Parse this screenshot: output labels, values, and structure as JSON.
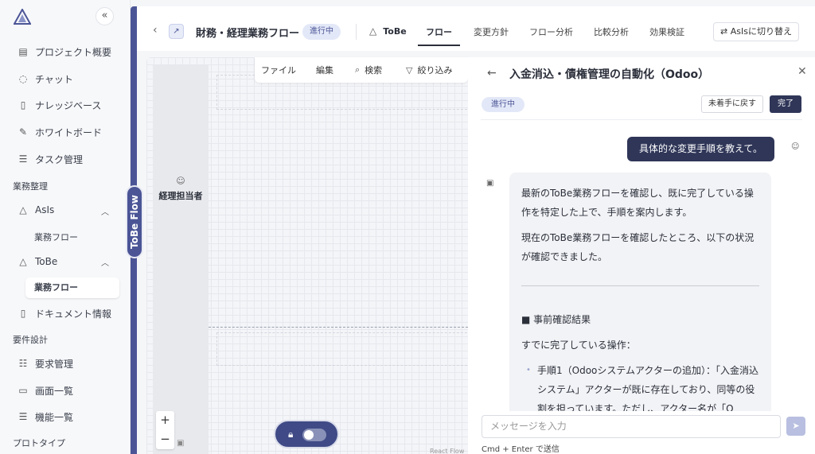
{
  "sidebar": {
    "collapse_icon": "«",
    "items": [
      {
        "icon": "clipboard-icon",
        "label": "プロジェクト概要"
      },
      {
        "icon": "chat-icon",
        "label": "チャット"
      },
      {
        "icon": "book-icon",
        "label": "ナレッジベース"
      },
      {
        "icon": "pen-icon",
        "label": "ホワイトボード"
      },
      {
        "icon": "task-list-icon",
        "label": "タスク管理"
      }
    ],
    "section_business": "業務整理",
    "asis_label": "AsIs",
    "asis_sub": "業務フロー",
    "tobe_label": "ToBe",
    "tobe_sub": "業務フロー",
    "doc_label": "ドキュメント情報",
    "section_requirements": "要件設計",
    "req_items": [
      {
        "icon": "list-icon",
        "label": "要求管理"
      },
      {
        "icon": "monitor-icon",
        "label": "画面一覧"
      },
      {
        "icon": "list-icon",
        "label": "機能一覧"
      }
    ],
    "section_prototype": "プロトタイプ"
  },
  "flow_tag": "ToBe Flow",
  "header": {
    "title": "財務・経理業務フロー",
    "status": "進行中",
    "tobe": "ToBe",
    "tabs": [
      "フロー",
      "変更方針",
      "フロー分析",
      "比較分析",
      "効果検証"
    ],
    "active_tab": "フロー",
    "switch_label": "AsIsに切り替え"
  },
  "canvas": {
    "actor": "経理担当者",
    "toolbar": [
      {
        "icon": "",
        "label": "ファイル"
      },
      {
        "icon": "",
        "label": "編集"
      },
      {
        "icon": "search-icon",
        "label": "検索"
      },
      {
        "icon": "filter-icon",
        "label": "絞り込み"
      }
    ],
    "zoom_in": "+",
    "zoom_out": "−",
    "watermark": "React Flow"
  },
  "panel": {
    "title": "入金消込・債権管理の自動化（Odoo）",
    "status": "進行中",
    "revert_button": "未着手に戻す",
    "done_button": "完了",
    "user_message": "具体的な変更手順を教えて。",
    "bot_p1": "最新のToBe業務フローを確認し、既に完了している操作を特定した上で、手順を案内します。",
    "bot_p2": "現在のToBe業務フローを確認したところ、以下の状況が確認できました。",
    "bot_heading": "■ 事前確認結果",
    "bot_p3": "すでに完了している操作：",
    "bot_list_1": "手順1（Odooシステムアクターの追加）：「入金消込システム」アクターが既に存在しており、同等の役割を担っています。ただし、アクター名が「O",
    "input_placeholder": "メッセージを入力",
    "hint": "Cmd + Enter で送信"
  },
  "colors": {
    "accent": "#4b5596",
    "dark_button": "#2f3658",
    "pill_bg": "#e3e8f8"
  }
}
